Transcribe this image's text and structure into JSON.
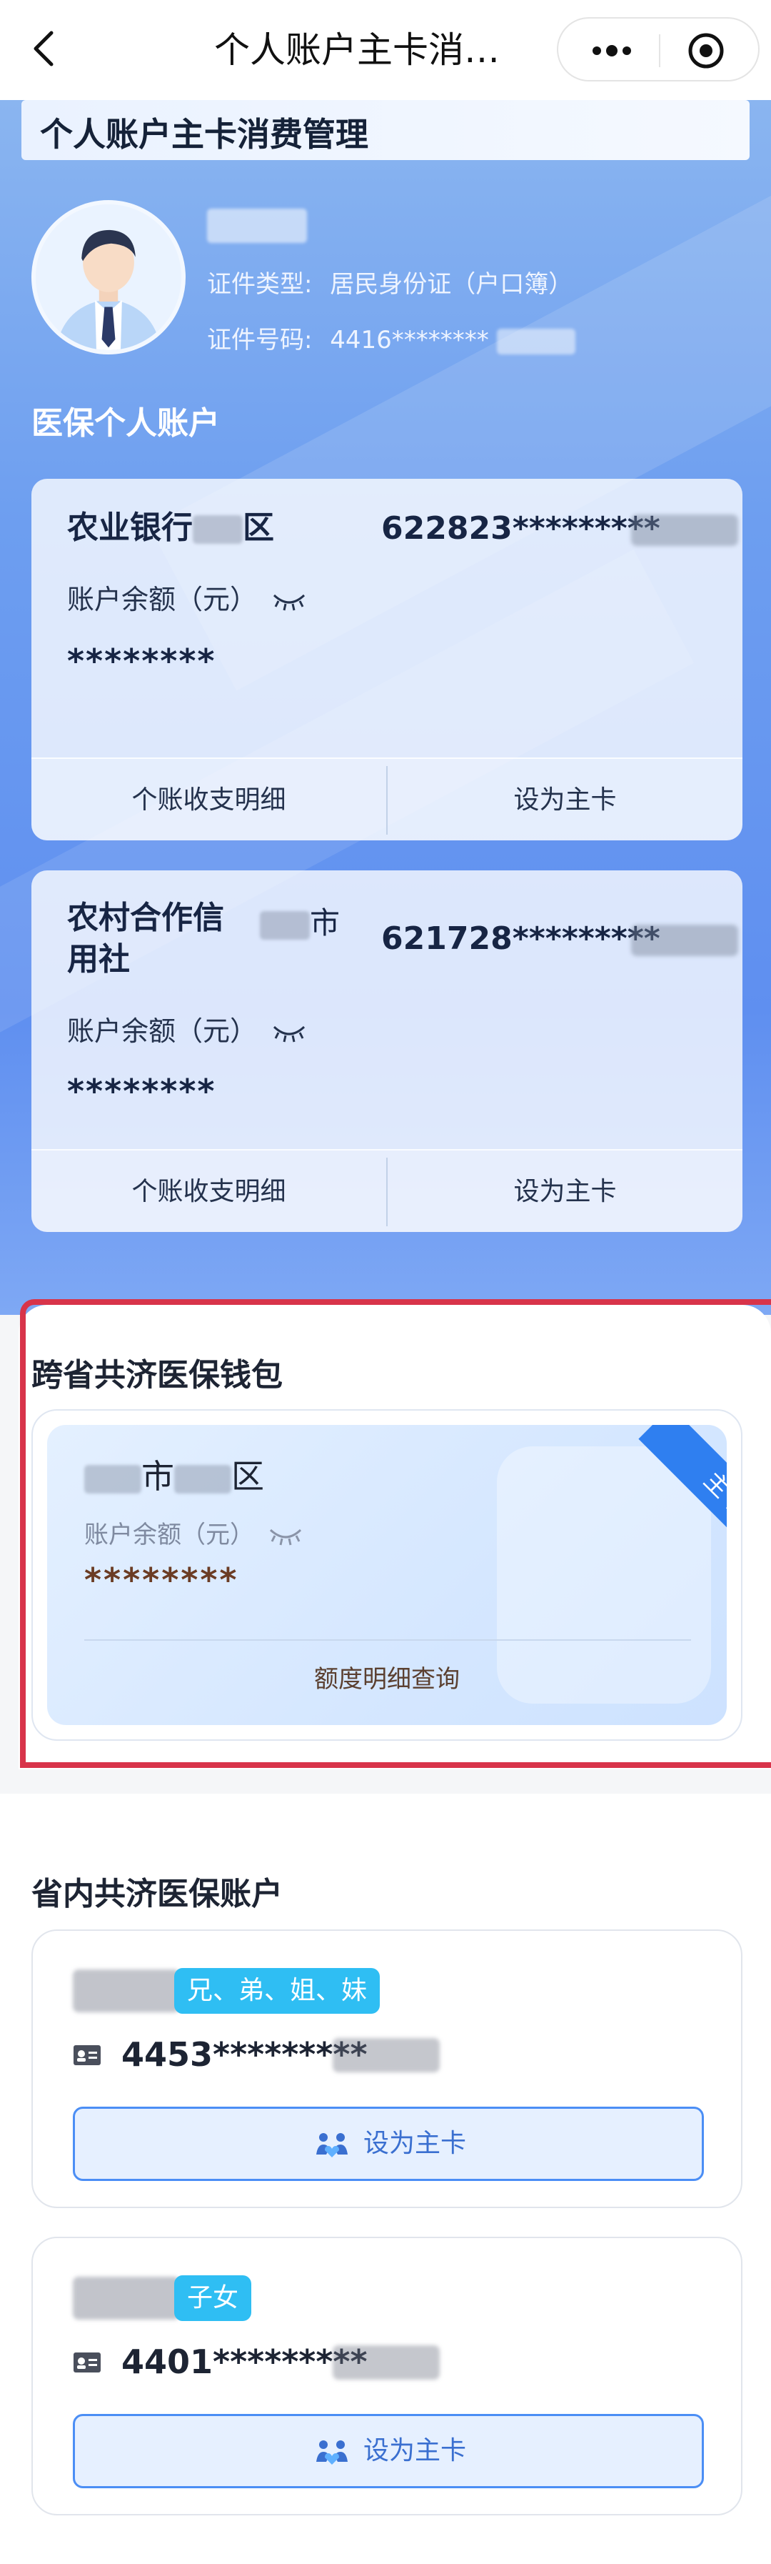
{
  "nav": {
    "title": "个人账户主卡消…"
  },
  "banner": {
    "title": "个人账户主卡消费管理"
  },
  "profile": {
    "id_type_label": "证件类型:",
    "id_type_value": "居民身份证（户口簿）",
    "id_no_label": "证件号码:",
    "id_no_value": "4416********"
  },
  "personal_account": {
    "section_title": "医保个人账户",
    "cards": [
      {
        "bank": "农业银行",
        "bank_suffix": "区",
        "account": "622823*********",
        "balance_label": "账户余额（元）",
        "balance": "********",
        "detail_button": "个账收支明细",
        "set_main_button": "设为主卡"
      },
      {
        "bank_line1": "农村合作信",
        "bank_line2": "用社",
        "bank_suffix": "市",
        "account": "621728*********",
        "balance_label": "账户余额（元）",
        "balance": "********",
        "detail_button": "个账收支明细",
        "set_main_button": "设为主卡"
      }
    ]
  },
  "wallet": {
    "section_title": "跨省共济医保钱包",
    "place_mid": "市",
    "place_end": "区",
    "balance_label": "账户余额（元）",
    "balance": "********",
    "query_button": "额度明细查询",
    "ribbon": "主卡"
  },
  "provincial": {
    "section_title": "省内共济医保账户",
    "accounts": [
      {
        "relation": "兄、弟、姐、妹",
        "id_number": "4453*********",
        "set_main_button": "设为主卡"
      },
      {
        "relation": "子女",
        "id_number": "4401*********",
        "set_main_button": "设为主卡"
      }
    ]
  },
  "colors": {
    "accent_blue": "#4b8ef5",
    "highlight_red": "#d8344a",
    "relation_tag": "#2fbef3",
    "ribbon_blue": "#2f7ff0"
  }
}
